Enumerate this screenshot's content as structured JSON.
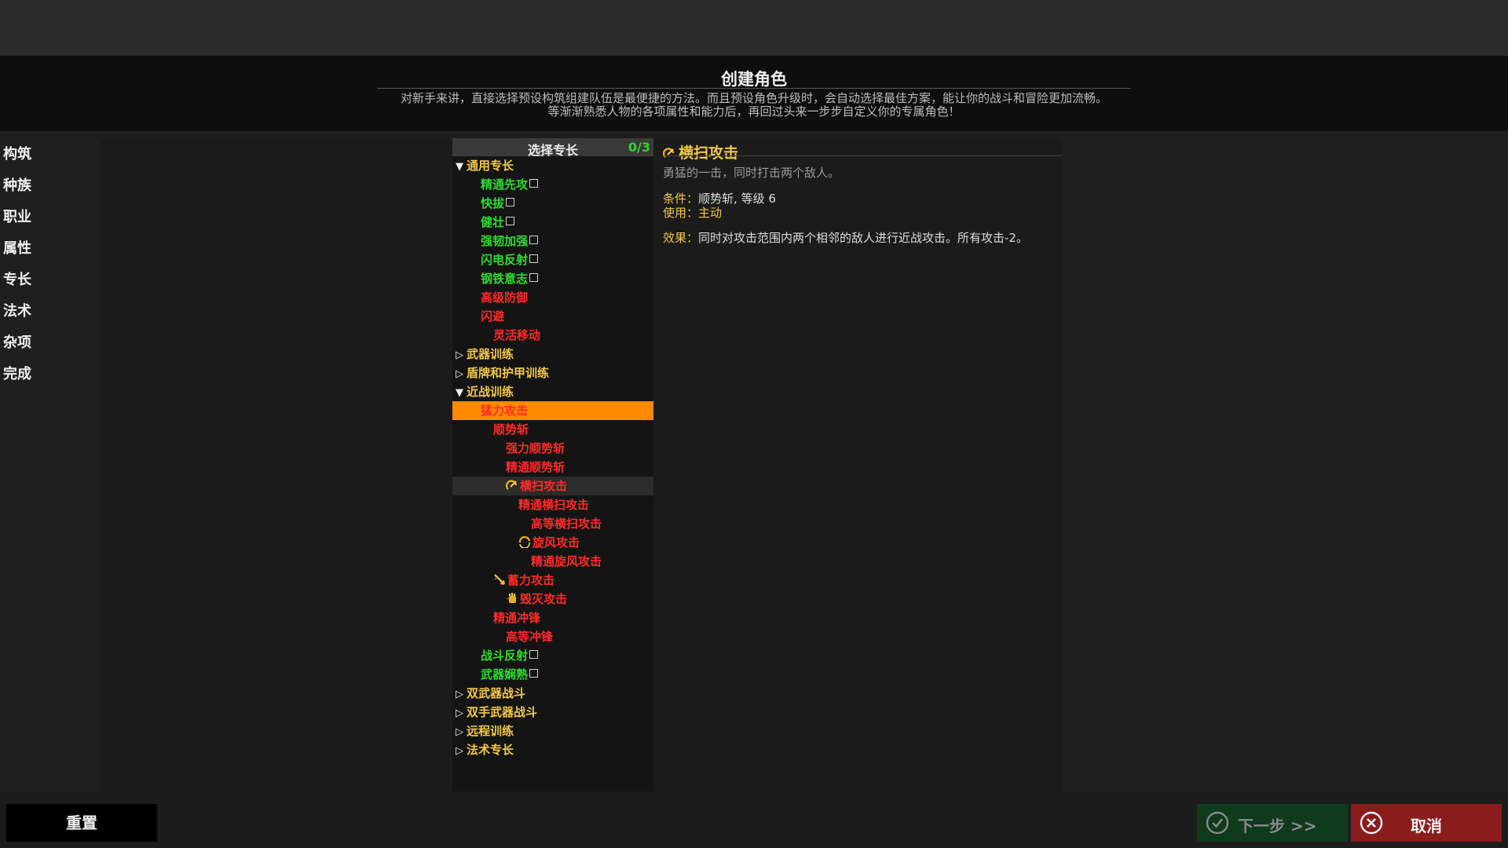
{
  "header": {
    "title": "创建角色",
    "desc_line1": "对新手来讲，直接选择预设构筑组建队伍是最便捷的方法。而且预设角色升级时，会自动选择最佳方案，能让你的战斗和冒险更加流畅。",
    "desc_line2": "等渐渐熟悉人物的各项属性和能力后，再回过头来一步步自定义你的专属角色！"
  },
  "steps": [
    "构筑",
    "种族",
    "职业",
    "属性",
    "专长",
    "法术",
    "杂项",
    "完成"
  ],
  "tree": {
    "header": "选择专长",
    "count": "0/3",
    "rows": [
      {
        "text": "通用专长",
        "level": 0,
        "type": "cat",
        "expanded": true
      },
      {
        "text": "精通先攻",
        "level": 1,
        "color": "green",
        "check": true
      },
      {
        "text": "快拔",
        "level": 1,
        "color": "green",
        "check": true
      },
      {
        "text": "健壮",
        "level": 1,
        "color": "green",
        "check": true
      },
      {
        "text": "强韧加强",
        "level": 1,
        "color": "green",
        "check": true
      },
      {
        "text": "闪电反射",
        "level": 1,
        "color": "green",
        "check": true
      },
      {
        "text": "钢铁意志",
        "level": 1,
        "color": "green",
        "check": true
      },
      {
        "text": "高级防御",
        "level": 1,
        "color": "red"
      },
      {
        "text": "闪避",
        "level": 1,
        "color": "red"
      },
      {
        "text": "灵活移动",
        "level": 2,
        "color": "red"
      },
      {
        "text": "武器训练",
        "level": 0,
        "type": "cat",
        "expanded": false
      },
      {
        "text": "盾牌和护甲训练",
        "level": 0,
        "type": "cat",
        "expanded": false
      },
      {
        "text": "近战训练",
        "level": 0,
        "type": "cat",
        "expanded": true
      },
      {
        "text": "猛力攻击",
        "level": 1,
        "color": "red",
        "selected": true
      },
      {
        "text": "顺势斩",
        "level": 2,
        "color": "red"
      },
      {
        "text": "强力顺势斩",
        "level": 3,
        "color": "red"
      },
      {
        "text": "精通顺势斩",
        "level": 3,
        "color": "red"
      },
      {
        "text": "横扫攻击",
        "level": 3,
        "color": "red",
        "icon": "sweep",
        "hover": true
      },
      {
        "text": "精通横扫攻击",
        "level": 4,
        "color": "red"
      },
      {
        "text": "高等横扫攻击",
        "level": 5,
        "color": "red"
      },
      {
        "text": "旋风攻击",
        "level": 4,
        "color": "red",
        "icon": "whirlwind"
      },
      {
        "text": "精通旋风攻击",
        "level": 5,
        "color": "red"
      },
      {
        "text": "蓄力攻击",
        "level": 2,
        "color": "red",
        "icon": "charge"
      },
      {
        "text": "毁灭攻击",
        "level": 3,
        "color": "red",
        "icon": "fist"
      },
      {
        "text": "精通冲锋",
        "level": 2,
        "color": "red"
      },
      {
        "text": "高等冲锋",
        "level": 3,
        "color": "red"
      },
      {
        "text": "战斗反射",
        "level": 1,
        "color": "green",
        "check": true
      },
      {
        "text": "武器娴熟",
        "level": 1,
        "color": "green",
        "check": true
      },
      {
        "text": "双武器战斗",
        "level": 0,
        "type": "cat",
        "expanded": false
      },
      {
        "text": "双手武器战斗",
        "level": 0,
        "type": "cat",
        "expanded": false
      },
      {
        "text": "远程训练",
        "level": 0,
        "type": "cat",
        "expanded": false
      },
      {
        "text": "法术专长",
        "level": 0,
        "type": "cat",
        "expanded": false
      }
    ]
  },
  "detail": {
    "icon": "sweep-icon",
    "title": "横扫攻击",
    "desc": "勇猛的一击，同时打击两个敌人。",
    "cond_label": "条件：",
    "cond_value": "顺势斩, 等级 6",
    "use_label": "使用：",
    "use_value": "主动",
    "effect_label": "效果：",
    "effect_value": "同时对攻击范围内两个相邻的敌人进行近战攻击。所有攻击-2。"
  },
  "buttons": {
    "reset": "重置",
    "next": "下一步 >>",
    "cancel": "取消"
  },
  "colors": {
    "category": "#f2c84b",
    "available": "#2fdc2f",
    "unavailable": "#ff2a2a",
    "selected_row": "#ff8a00",
    "next_button": "#0f3a1c",
    "cancel_button": "#8a1c1c"
  }
}
